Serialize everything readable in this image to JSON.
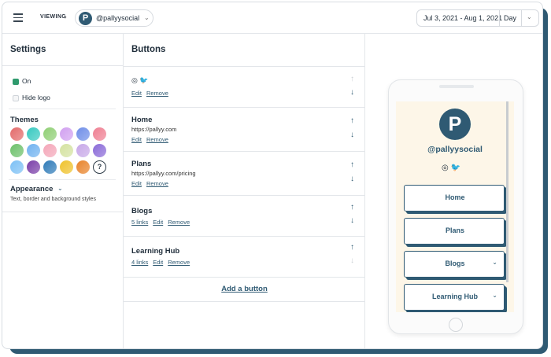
{
  "topbar": {
    "viewing_label": "VIEWING",
    "account_logo_letter": "P",
    "account_name": "@pallyysocial",
    "date_range": "Jul 3, 2021 - Aug 1, 2021",
    "period": "Day"
  },
  "settings": {
    "title": "Settings",
    "on_label": "On",
    "hide_logo_label": "Hide logo",
    "themes_title": "Themes",
    "help_symbol": "?",
    "appearance_title": "Appearance",
    "appearance_desc": "Text, border and background styles",
    "theme_swatches": [
      "#e36a6a",
      "#37c9c0",
      "#8fcf74",
      "#d1a0f0",
      "#6f8ee8",
      "#ef7f92",
      "#6cc06a",
      "#6fb2f0",
      "#f4a6b8",
      "#d4e2a0",
      "#c7a8e8",
      "#8a6ad8",
      "#7cc0f5",
      "#7a3ea8",
      "#2f7bb8",
      "#efc22c",
      "#e8832a"
    ]
  },
  "buttons": {
    "title": "Buttons",
    "edit_label": "Edit",
    "remove_label": "Remove",
    "social_glyphs": "◎ 🐦",
    "rows": [
      {
        "title": "",
        "url": "",
        "links": ""
      },
      {
        "title": "Home",
        "url": "https://pallyy.com",
        "links": ""
      },
      {
        "title": "Plans",
        "url": "https://pallyy.com/pricing",
        "links": ""
      },
      {
        "title": "Blogs",
        "url": "",
        "links": "5 links"
      },
      {
        "title": "Learning Hub",
        "url": "",
        "links": "4 links"
      }
    ],
    "add_label": "Add a button"
  },
  "preview": {
    "logo_letter": "P",
    "handle": "@pallyysocial",
    "social_glyphs": "◎  🐦",
    "buttons": [
      {
        "label": "Home",
        "has_chevron": false
      },
      {
        "label": "Plans",
        "has_chevron": false
      },
      {
        "label": "Blogs",
        "has_chevron": true
      },
      {
        "label": "Learning Hub",
        "has_chevron": true
      }
    ]
  },
  "colors": {
    "brand": "#2f5a73",
    "preview_background": "#fdf6e8",
    "check_on": "#2f9a6d"
  },
  "icons": [
    "menu-icon",
    "chevron-down-icon",
    "instagram-icon",
    "twitter-icon",
    "arrow-up-icon",
    "arrow-down-icon",
    "help-icon"
  ]
}
